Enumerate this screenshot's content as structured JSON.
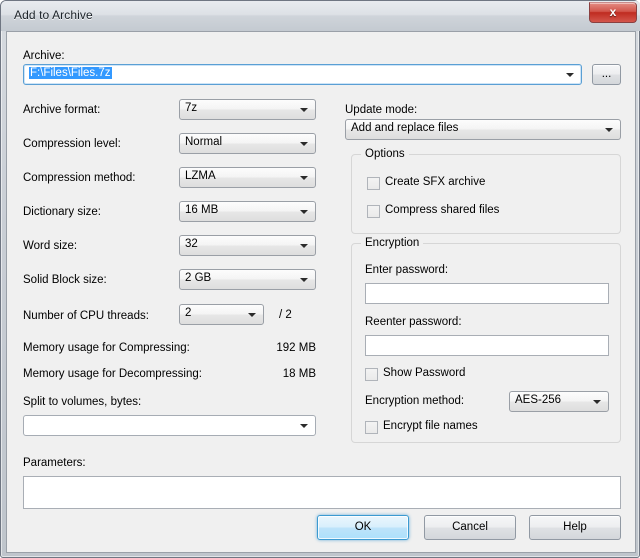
{
  "window": {
    "title": "Add to Archive",
    "close_label": "x"
  },
  "archive": {
    "label": "Archive:",
    "path": "F:\\Files\\Files.7z",
    "browse_label": "..."
  },
  "left_column": {
    "archive_format": {
      "label": "Archive format:",
      "value": "7z"
    },
    "compression_level": {
      "label": "Compression level:",
      "value": "Normal"
    },
    "compression_method": {
      "label": "Compression method:",
      "value": "LZMA"
    },
    "dictionary_size": {
      "label": "Dictionary size:",
      "value": "16 MB"
    },
    "word_size": {
      "label": "Word size:",
      "value": "32"
    },
    "solid_block_size": {
      "label": "Solid Block size:",
      "value": "2 GB"
    },
    "cpu_threads": {
      "label": "Number of CPU threads:",
      "value": "2",
      "suffix": "/ 2"
    },
    "memory_compressing": {
      "label": "Memory usage for Compressing:",
      "value": "192 MB"
    },
    "memory_decompressing": {
      "label": "Memory usage for Decompressing:",
      "value": "18 MB"
    },
    "split_volumes": {
      "label": "Split to volumes, bytes:",
      "value": ""
    }
  },
  "right_column": {
    "update_mode": {
      "label": "Update mode:",
      "value": "Add and replace files"
    },
    "options": {
      "title": "Options",
      "create_sfx": "Create SFX archive",
      "compress_shared": "Compress shared files"
    },
    "encryption": {
      "title": "Encryption",
      "enter_password_label": "Enter password:",
      "enter_password_value": "",
      "reenter_password_label": "Reenter password:",
      "reenter_password_value": "",
      "show_password": "Show Password",
      "encryption_method_label": "Encryption method:",
      "encryption_method_value": "AES-256",
      "encrypt_file_names": "Encrypt file names"
    }
  },
  "parameters": {
    "label": "Parameters:",
    "value": ""
  },
  "buttons": {
    "ok": "OK",
    "cancel": "Cancel",
    "help": "Help"
  },
  "colors": {
    "selection_blue": "#3399ff",
    "default_button_blue": "#3c9ad1",
    "close_red": "#bf2b20",
    "client_bg": "#f0f0f0"
  }
}
